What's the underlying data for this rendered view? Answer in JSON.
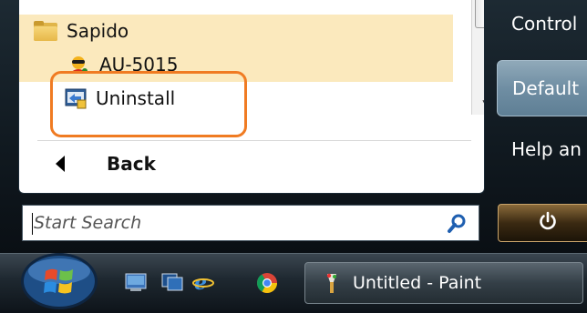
{
  "programs": {
    "items": [
      {
        "label": "Sapido",
        "icon": "folder-icon"
      },
      {
        "label": "AU-5015",
        "icon": "au-5015-icon"
      },
      {
        "label": "Uninstall",
        "icon": "uninstall-icon"
      }
    ],
    "back_label": "Back"
  },
  "right_menu": {
    "control_label": "Control",
    "default_label": "Default",
    "help_label": "Help an"
  },
  "search": {
    "placeholder": "Start Search"
  },
  "taskbar": {
    "task_label": "Untitled - Paint",
    "quick_launch": [
      "show-desktop-icon",
      "switch-windows-icon",
      "internet-explorer-icon",
      "chrome-icon"
    ]
  },
  "colors": {
    "highlight": "#f07b22",
    "selected_row": "#fbe9bd"
  }
}
